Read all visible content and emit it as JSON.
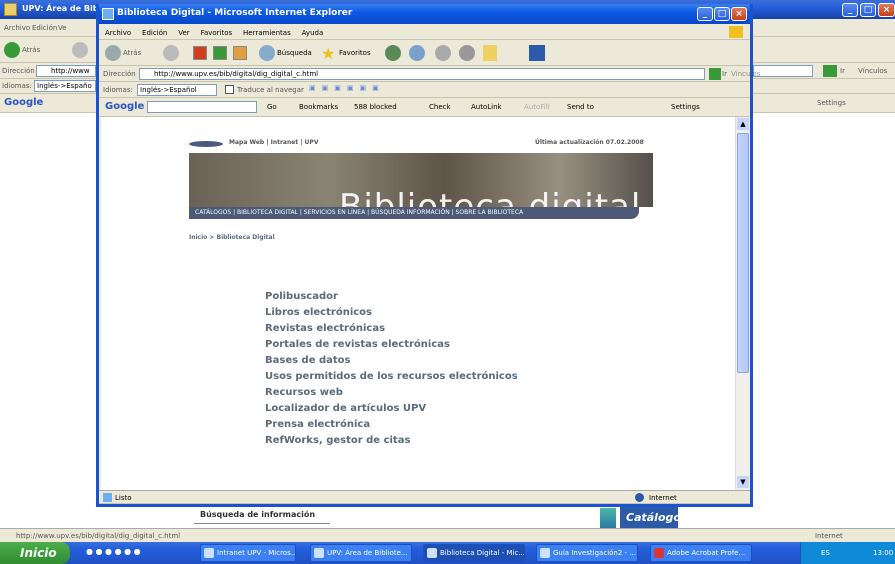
{
  "back_window": {
    "title": "UPV: Área de Biblioteca y Docum. Científica - Microsoft Internet Explorer",
    "menu": [
      "Archivo",
      "Edición",
      "Ve"
    ],
    "back_label": "Atrás",
    "address_label": "Dirección",
    "address_value": "http://www",
    "lang_label": "Idiomas:",
    "lang_value": "Inglés->Españo",
    "google_label": "Google",
    "go_label": "Ir",
    "links_label": "Vínculos",
    "settings_label": "Settings",
    "bottom_text": "Búsqueda de información",
    "catalogo": "Catálogo",
    "status_url": "http://www.upv.es/bib/digital/dig_digital_c.html",
    "status_zone": "Internet"
  },
  "front_window": {
    "title": "Biblioteca Digital - Microsoft Internet Explorer",
    "menu": [
      "Archivo",
      "Edición",
      "Ver",
      "Favoritos",
      "Herramientas",
      "Ayuda"
    ],
    "back_label": "Atrás",
    "search_label": "Búsqueda",
    "favorites_label": "Favoritos",
    "address_label": "Dirección",
    "address_value": "http://www.upv.es/bib/digital/dig_digital_c.html",
    "go_label": "Ir",
    "links_label": "Vínculos",
    "lang_label": "Idiomas:",
    "lang_value": "Inglés->Español",
    "translate_label": "Traduce al navegar",
    "google_label": "Google",
    "go_google": "Go",
    "bookmarks_label": "Bookmarks",
    "blocked_label": "588 blocked",
    "check_label": "Check",
    "autolink_label": "AutoLink",
    "autofill_label": "AutoFill",
    "sendto_label": "Send to",
    "settings_label": "Settings",
    "status_text": "Listo",
    "status_zone": "Internet"
  },
  "page": {
    "top_links": "Mapa Web | Intranet | UPV",
    "last_update": "Última actualización 07.02.2008",
    "banner_title": "Biblioteca digital",
    "nav": "CATÁLOGOS  |  BIBLIOTECA DIGITAL  |  SERVICIOS EN LÍNEA  |  BÚSQUEDA INFORMACIÓN  |  SOBRE LA BIBLIOTECA",
    "breadcrumb": "Inicio > Biblioteca Digital",
    "links": [
      "Polibuscador",
      "Libros electrónicos",
      "Revistas electrónicas",
      "Portales de revistas electrónicas",
      "Bases de datos",
      "Usos permitidos de los recursos electrónicos",
      "Recursos web",
      "Localizador de artículos UPV",
      "Prensa electrónica",
      "RefWorks, gestor de citas"
    ]
  },
  "taskbar": {
    "start": "Inicio",
    "buttons": [
      "Intranet UPV - Micros...",
      "UPV: Área de Bibliote...",
      "Biblioteca Digital - Mic...",
      "Guía Investigación2 - ...",
      "Adobe Acrobat Profe..."
    ],
    "lang": "ES",
    "clock": "13:00"
  }
}
